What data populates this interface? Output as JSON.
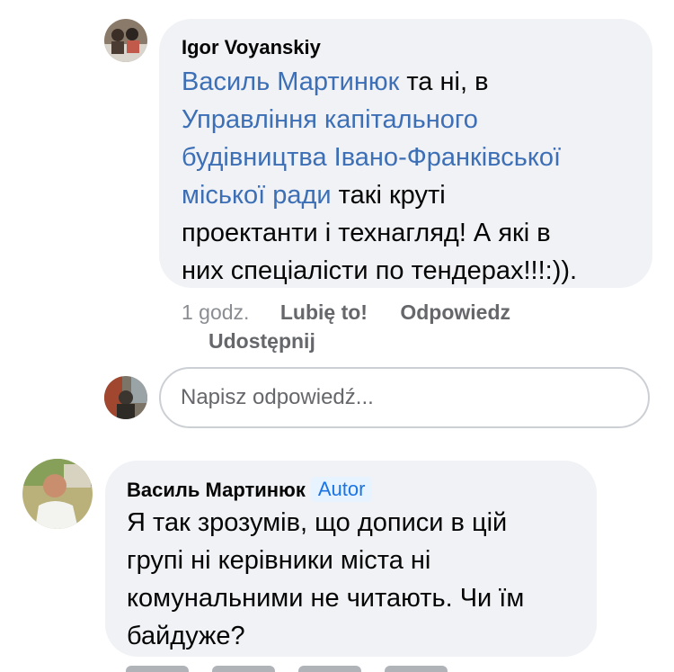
{
  "comment1": {
    "author": "Igor  Voyanskiy",
    "mention1": "Василь Мартинюк",
    "line1_tail": " та ні, в",
    "mention2_l1": "Управління капітального",
    "mention2_l2": "будівництва Івано-Франківської",
    "mention2_l3": "міської ради",
    "line4_tail": " такі круті",
    "line5": "проектанти і технагляд! А які в",
    "line6": "них спеціалісти по тендерах!!!:))."
  },
  "comment1_meta": {
    "time": "1 godz.",
    "like": "Lubię to!",
    "reply": "Odpowiedz",
    "share": "Udostępnij"
  },
  "reply_input": {
    "placeholder": "Napisz odpowiedź..."
  },
  "comment2": {
    "author": "Василь Мартинюк",
    "badge": "Autor",
    "line1": "Я так зрозумів, що дописи в цій",
    "line2": "групі ні керівники міста ні",
    "line3": "комунальними не читають. Чи їм",
    "line4": "байдуже?"
  },
  "colors": {
    "bubble": "#f0f2f5",
    "link": "#3d6fb6",
    "meta": "#65676b",
    "badge_bg": "#e7f3ff",
    "badge_text": "#1b74e4"
  }
}
